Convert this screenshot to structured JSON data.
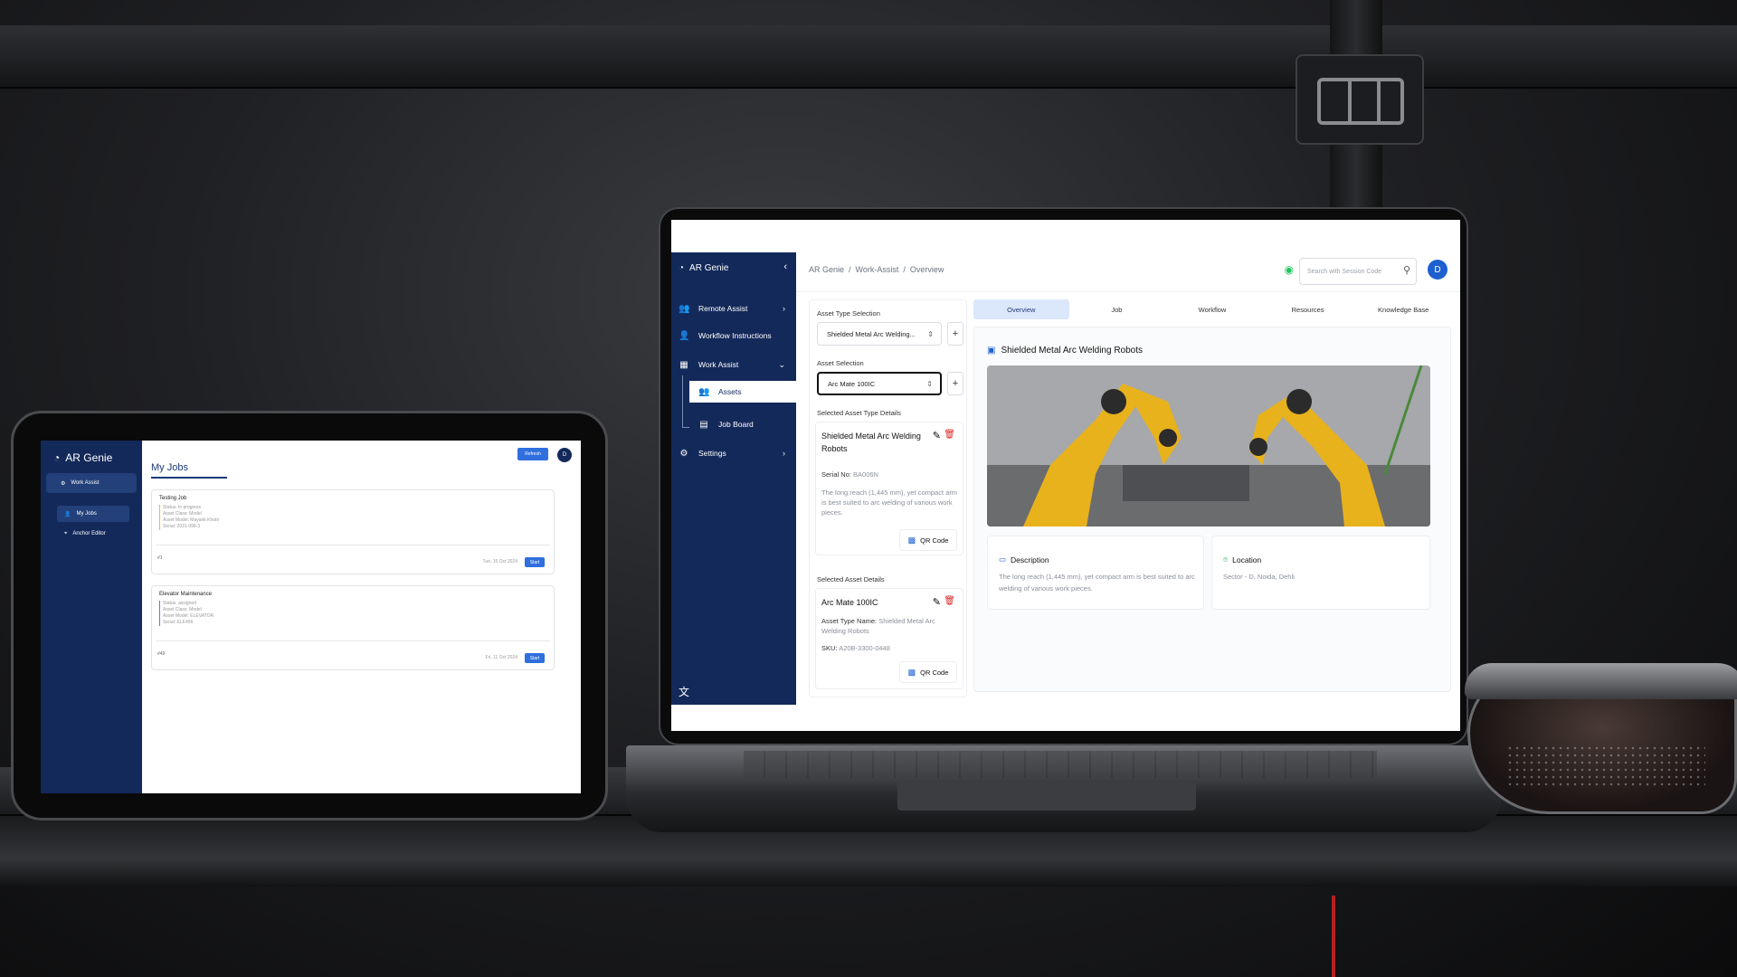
{
  "tablet": {
    "app_name": "AR Genie",
    "sidebar_button": "Work Assist",
    "nav": {
      "my_jobs": "My Jobs",
      "anchor_editor": "Anchor Editor"
    },
    "refresh": "Refresh",
    "avatar": "D",
    "page_title": "My Jobs",
    "jobs": [
      {
        "name": "Testing Job",
        "meta": "Status: In progress\nAsset Class: Model\nAsset Model: Mayank Khatri\nSerial: 2021-098-3",
        "num": "#1",
        "date": "Tue, 15 Oct 2024",
        "start": "Start"
      },
      {
        "name": "Elevator Maintenance",
        "meta": "Status: assigned\nAsset Class: Model\nAsset Model: ELEVATOR\nSerial: ELE456",
        "num": "#49",
        "date": "Fri, 11 Oct 2024",
        "start": "Start"
      }
    ]
  },
  "sidebar": {
    "app_name": "AR Genie",
    "collapse_icon": "chevron-left-icon",
    "items": [
      {
        "label": "Remote Assist",
        "icon": "users-icon"
      },
      {
        "label": "Workflow Instructions",
        "icon": "user-gear-icon"
      },
      {
        "label": "Work Assist",
        "icon": "grid-icon"
      },
      {
        "label": "Assets",
        "icon": "user-pair-icon"
      },
      {
        "label": "Job Board",
        "icon": "clipboard-icon"
      },
      {
        "label": "Settings",
        "icon": "gear-icon"
      }
    ],
    "language_icon": "translate-icon"
  },
  "header": {
    "breadcrumb": "AR Genie  /  Work-Assist  /  Overview",
    "search_placeholder": "Search with Session Code",
    "avatar": "D"
  },
  "left_panel": {
    "asset_type_label": "Asset Type Selection",
    "asset_type_value": "Shielded Metal Arc Welding...",
    "asset_label": "Asset Selection",
    "asset_value": "Arc Mate 100IC",
    "type_details_label": "Selected Asset Type Details",
    "type_card": {
      "title": "Shielded Metal Arc Welding Robots",
      "serial_label": "Serial No:",
      "serial": "BA006N",
      "description": "The long reach (1,445 mm), yet compact arm is best suited to arc welding of various work pieces.",
      "qr": "QR Code"
    },
    "asset_details_label": "Selected Asset Details",
    "asset_card": {
      "title": "Arc Mate 100IC",
      "type_label": "Asset Type Name:",
      "type_value": "Shielded Metal Arc Welding Robots",
      "sku_label": "SKU:",
      "sku": "A20B-3300-0448",
      "qr": "QR Code"
    }
  },
  "tabs": [
    "Overview",
    "Job",
    "Workflow",
    "Resources",
    "Knowledge Base"
  ],
  "overview": {
    "title": "Shielded Metal Arc Welding Robots",
    "description_title": "Description",
    "description": "The long reach (1,445 mm), yet compact arm is best suited to arc welding of various work pieces.",
    "location_title": "Location",
    "location": "Sector - D, Noida, Dehli"
  },
  "colors": {
    "sidebar": "#13295a",
    "accent": "#1d5fcf",
    "delete": "#dc2626",
    "online": "#22c55e"
  }
}
